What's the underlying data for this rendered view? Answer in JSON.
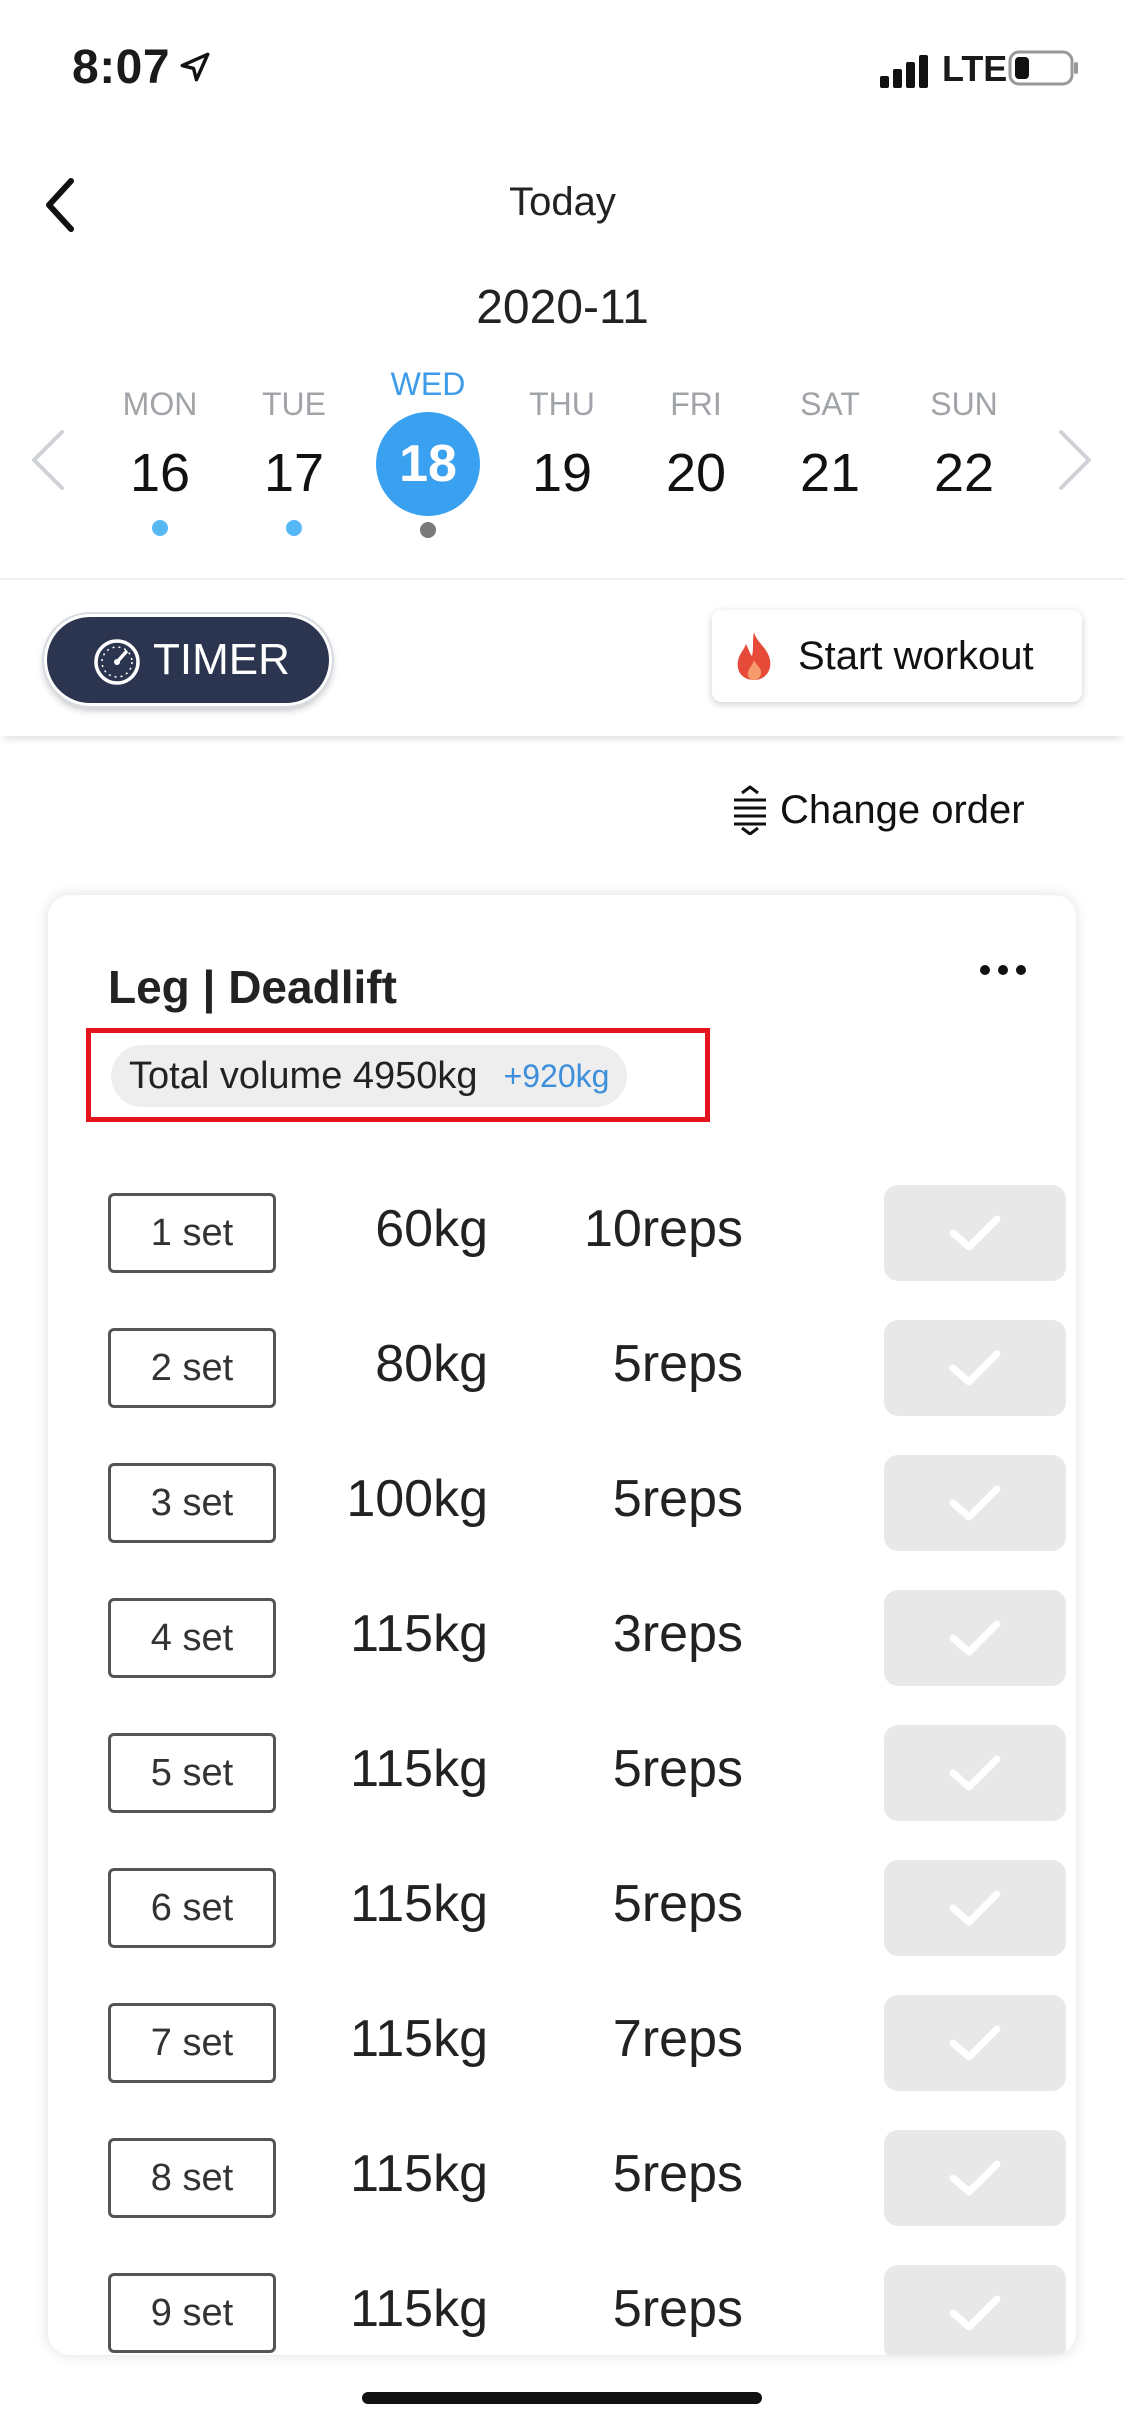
{
  "status_bar": {
    "time": "8:07",
    "network": "LTE"
  },
  "header": {
    "title": "Today"
  },
  "calendar": {
    "month": "2020-11",
    "days": [
      {
        "dow": "MON",
        "num": "16",
        "dot": "#56b8f5"
      },
      {
        "dow": "TUE",
        "num": "17",
        "dot": "#56b8f5"
      },
      {
        "dow": "WED",
        "num": "18",
        "dot": "#7a7a7a",
        "selected": true
      },
      {
        "dow": "THU",
        "num": "19",
        "dot": ""
      },
      {
        "dow": "FRI",
        "num": "20",
        "dot": ""
      },
      {
        "dow": "SAT",
        "num": "21",
        "dot": ""
      },
      {
        "dow": "SUN",
        "num": "22",
        "dot": ""
      }
    ]
  },
  "toolbar": {
    "timer_label": "TIMER",
    "start_label": "Start workout"
  },
  "change_order_label": "Change order",
  "exercise": {
    "title": "Leg | Deadlift",
    "total_volume": "Total volume 4950kg",
    "volume_diff": "+920kg",
    "sets": [
      {
        "label": "1 set",
        "weight": "60kg",
        "reps": "10reps"
      },
      {
        "label": "2 set",
        "weight": "80kg",
        "reps": "5reps"
      },
      {
        "label": "3 set",
        "weight": "100kg",
        "reps": "5reps"
      },
      {
        "label": "4 set",
        "weight": "115kg",
        "reps": "3reps"
      },
      {
        "label": "5 set",
        "weight": "115kg",
        "reps": "5reps"
      },
      {
        "label": "6 set",
        "weight": "115kg",
        "reps": "5reps"
      },
      {
        "label": "7 set",
        "weight": "115kg",
        "reps": "7reps"
      },
      {
        "label": "8 set",
        "weight": "115kg",
        "reps": "5reps"
      },
      {
        "label": "9 set",
        "weight": "115kg",
        "reps": "5reps"
      }
    ]
  },
  "colors": {
    "accent": "#3aa0f0",
    "timer_bg": "#2b3550",
    "highlight_border": "#e5131e",
    "fire": "#e84a3a"
  }
}
